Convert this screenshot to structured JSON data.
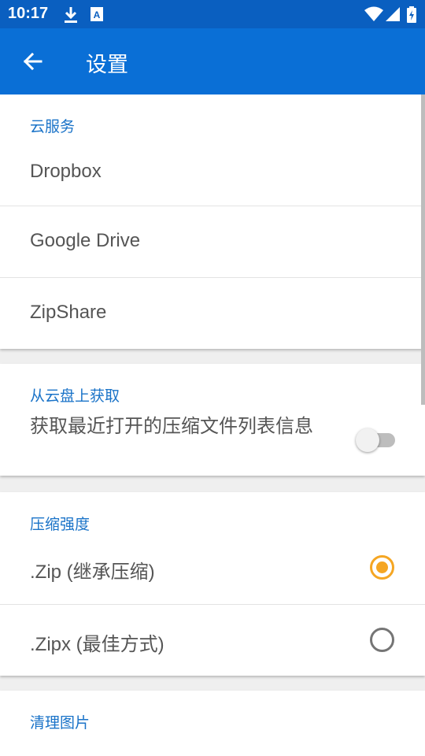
{
  "status_bar": {
    "time": "10:17",
    "left_icons": [
      "download-icon",
      "accessibility-icon"
    ],
    "right_icons": [
      "wifi-icon",
      "signal-icon",
      "battery-charging-icon"
    ]
  },
  "app_bar": {
    "title": "设置",
    "back_icon": "arrow-left-icon",
    "color": "#0a6fd6"
  },
  "sections": [
    {
      "category": "云服务",
      "items": [
        {
          "label": "Dropbox"
        },
        {
          "label": "Google Drive"
        },
        {
          "label": "ZipShare"
        }
      ]
    },
    {
      "category": "从云盘上获取",
      "items": [
        {
          "label": "获取最近打开的压缩文件列表信息",
          "toggle_on": false
        }
      ]
    },
    {
      "category": "压缩强度",
      "items": [
        {
          "label": ".Zip (继承压缩)",
          "selected": true
        },
        {
          "label": ".Zipx (最佳方式)",
          "selected": false
        }
      ]
    },
    {
      "category": "清理图片",
      "items": []
    }
  ],
  "colors": {
    "accent": "#1a73c8",
    "radio_selected": "#f5a623",
    "status_bar": "#0a5fc0"
  }
}
